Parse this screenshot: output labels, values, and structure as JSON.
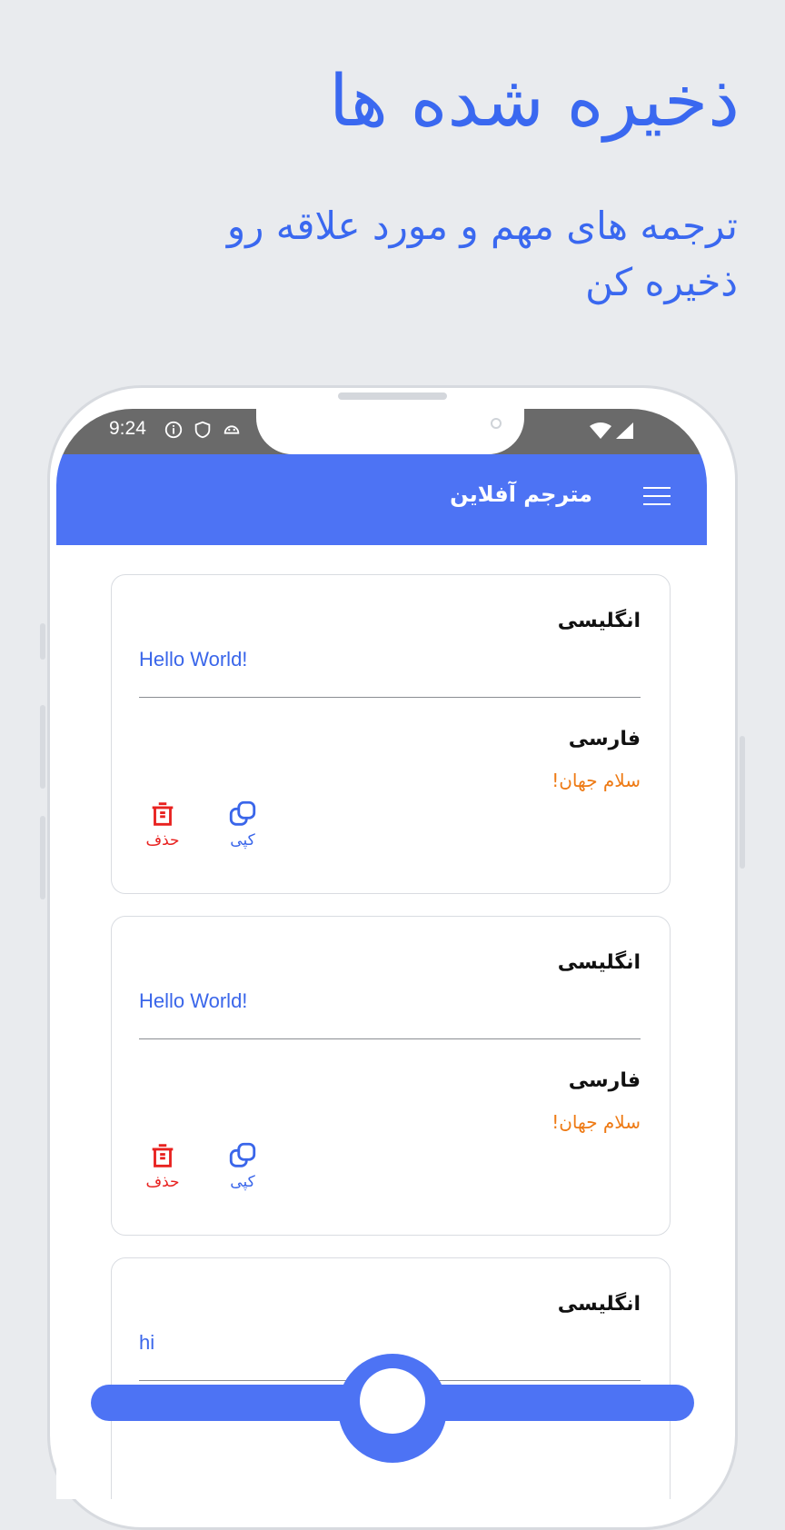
{
  "promo": {
    "title": "ذخیره شده ها",
    "subtitle": "ترجمه های مهم و مورد علاقه رو ذخیره کن"
  },
  "status_bar": {
    "time": "9:24",
    "icons": [
      "info-icon",
      "shield-icon",
      "android-icon"
    ],
    "right_icons": [
      "wifi-icon",
      "signal-icon"
    ]
  },
  "app_bar": {
    "title": "مترجم آفلاین",
    "menu_icon": "hamburger-menu-icon"
  },
  "cards": [
    {
      "source_label": "انگلیسی",
      "source_text": "Hello World!",
      "target_label": "فارسی",
      "target_text": "سلام جهان!",
      "copy_label": "کپی",
      "delete_label": "حذف"
    },
    {
      "source_label": "انگلیسی",
      "source_text": "Hello World!",
      "target_label": "فارسی",
      "target_text": "سلام جهان!",
      "copy_label": "کپی",
      "delete_label": "حذف"
    },
    {
      "source_label": "انگلیسی",
      "source_text": "hi"
    }
  ],
  "colors": {
    "accent": "#4d73f4",
    "source_text": "#3a66ea",
    "target_text": "#ee7a14",
    "delete": "#e8211f",
    "background": "#e9ebee"
  }
}
